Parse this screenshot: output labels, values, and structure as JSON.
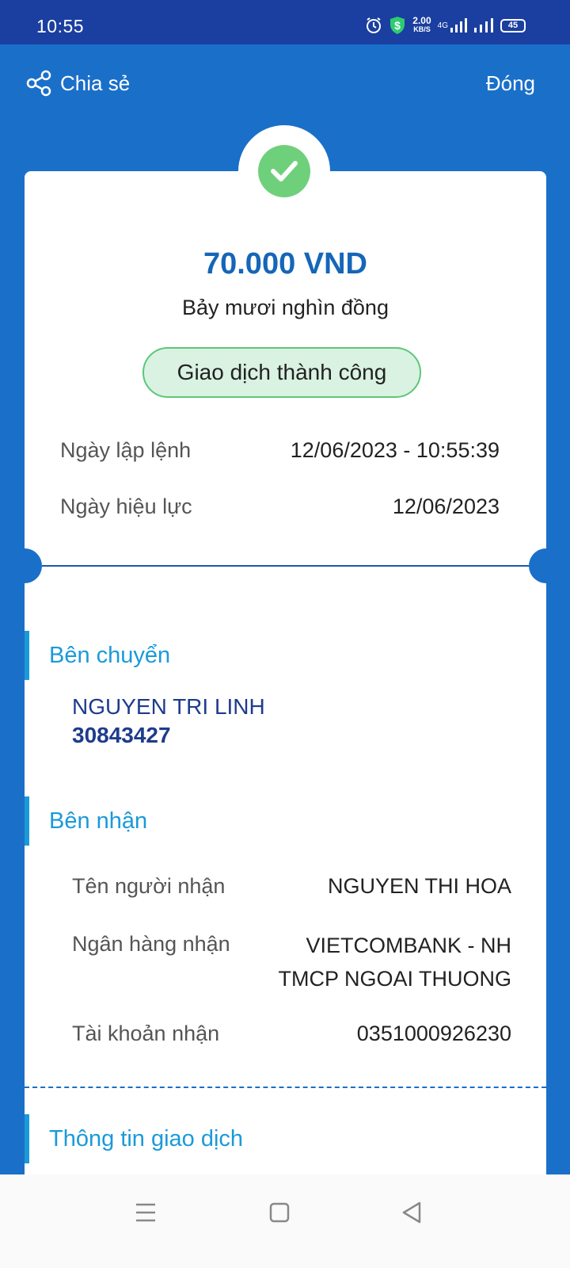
{
  "status_bar": {
    "time": "10:55",
    "net_speed": "2.00",
    "net_speed_unit": "KB/S",
    "network_type": "4G",
    "battery": "45"
  },
  "header": {
    "share_label": "Chia sẻ",
    "close_label": "Đóng"
  },
  "receipt": {
    "amount": "70.000 VND",
    "amount_words": "Bảy mươi nghìn đồng",
    "status": "Giao dịch thành công",
    "created_label": "Ngày lập lệnh",
    "created_value": "12/06/2023 - 10:55:39",
    "effective_label": "Ngày hiệu lực",
    "effective_value": "12/06/2023"
  },
  "sender": {
    "section_title": "Bên chuyển",
    "name": "NGUYEN TRI LINH",
    "account": "30843427"
  },
  "receiver": {
    "section_title": "Bên nhận",
    "name_label": "Tên người nhận",
    "name_value": "NGUYEN THI HOA",
    "bank_label": "Ngân hàng nhận",
    "bank_value_line1": "VIETCOMBANK - NH",
    "bank_value_line2": "TMCP NGOAI THUONG",
    "account_label": "Tài khoản nhận",
    "account_value": "0351000926230"
  },
  "transaction": {
    "section_title": "Thông tin giao dịch"
  },
  "colors": {
    "primary_bg": "#1a6fc9",
    "status_bar_bg": "#1a3fa0",
    "amount": "#1566b8",
    "section_accent": "#1a9ad9",
    "success_green": "#6fd07c"
  }
}
